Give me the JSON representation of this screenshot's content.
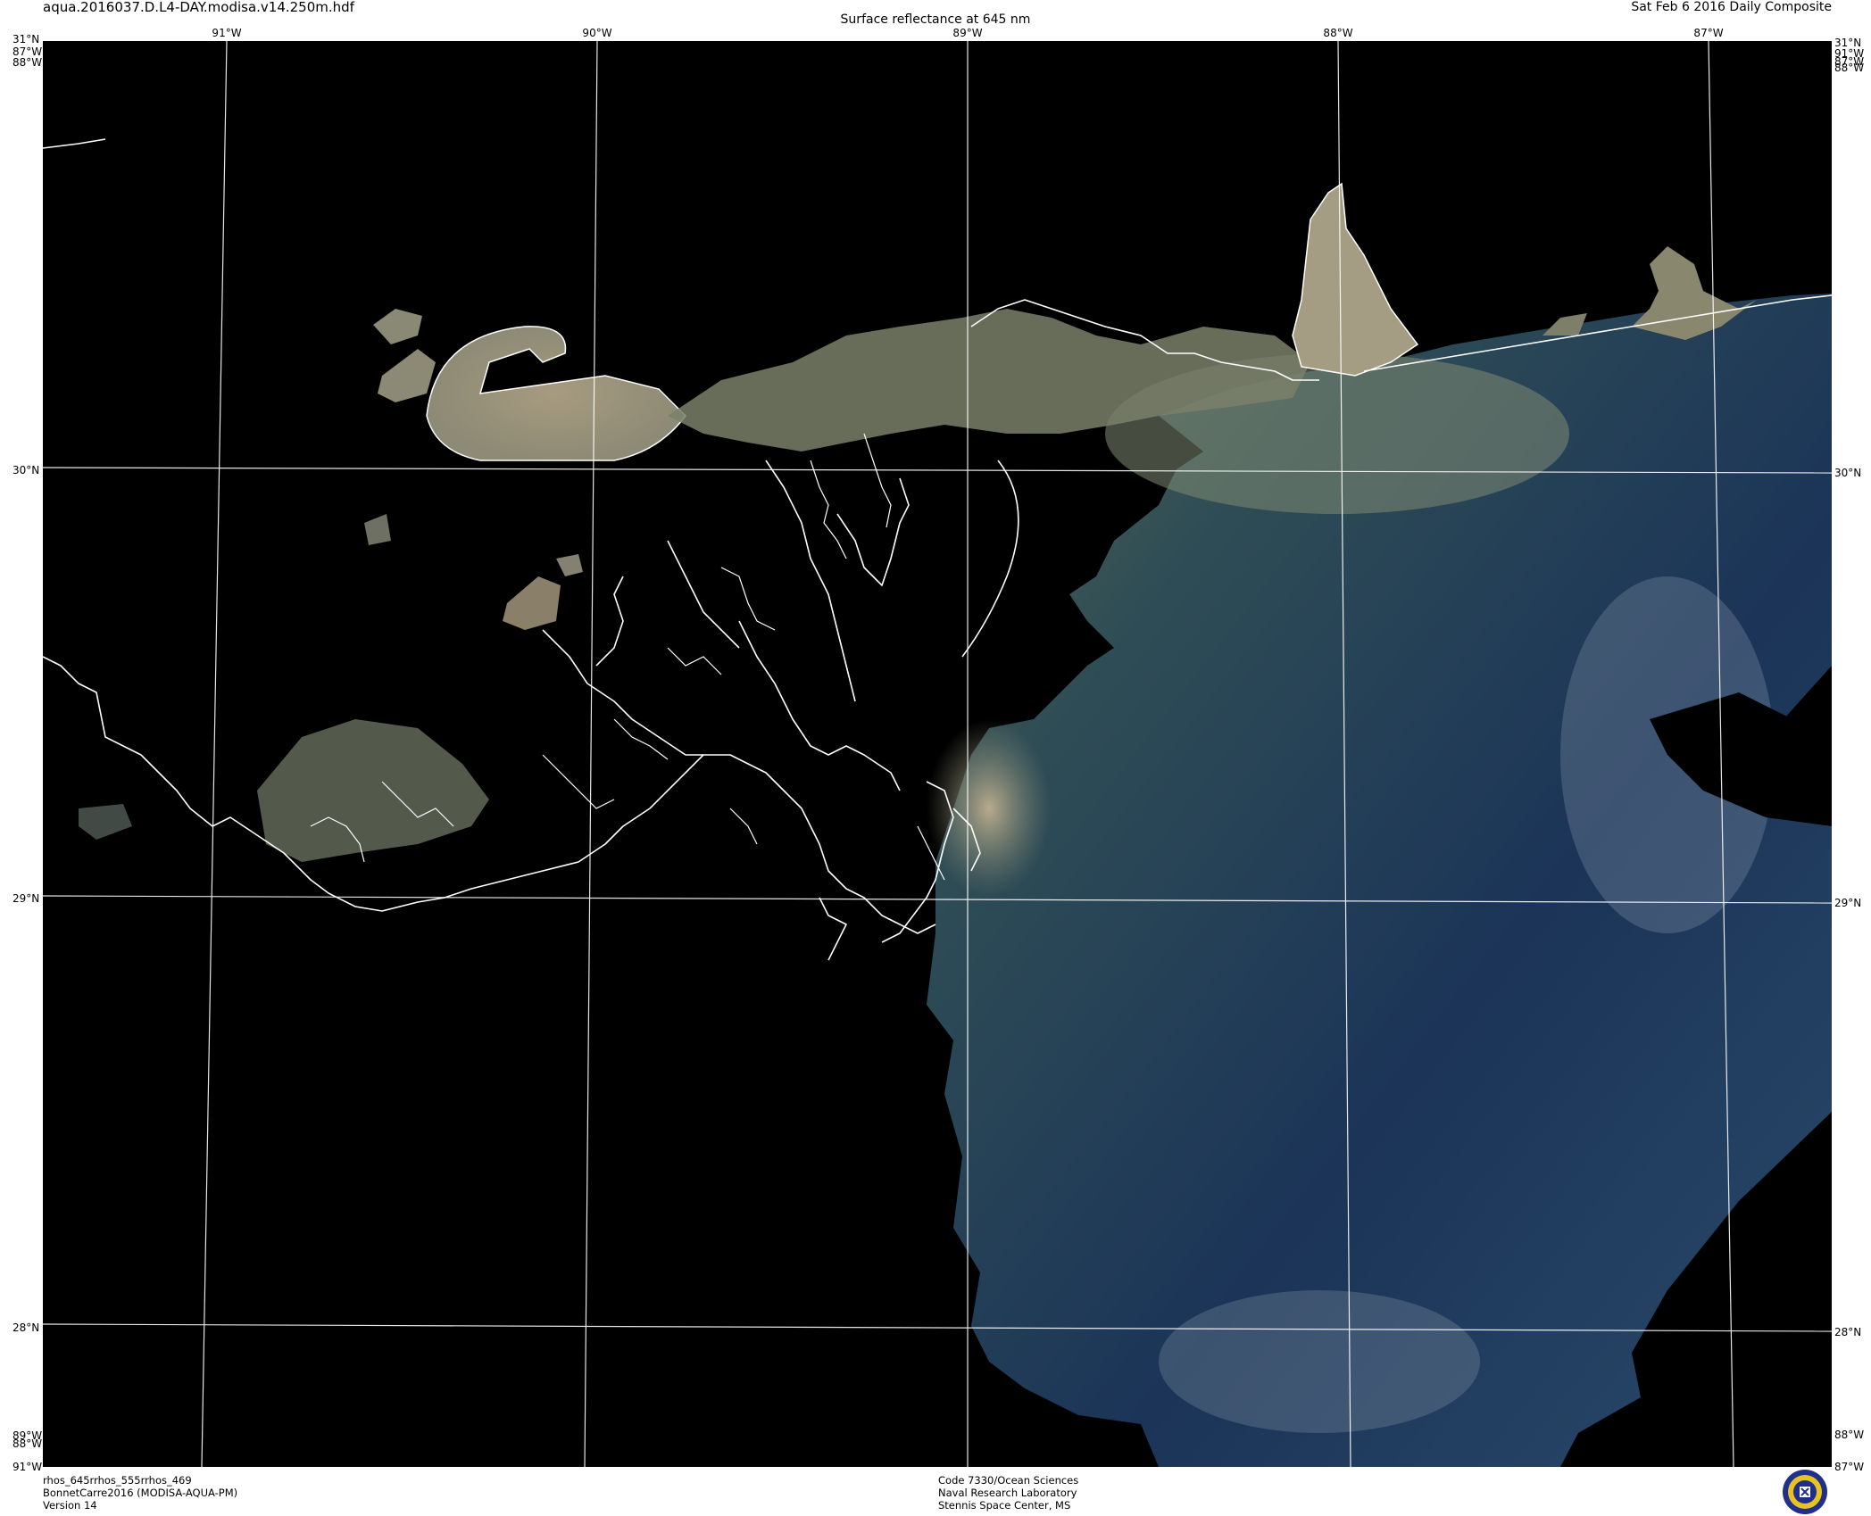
{
  "header": {
    "filename": "aqua.2016037.D.L4-DAY.modisa.v14.250m.hdf",
    "title": "Surface reflectance at 645 nm",
    "date": "Sat Feb  6 2016 Daily Composite"
  },
  "map": {
    "top_lon_labels": [
      "91°W",
      "90°W",
      "89°W",
      "88°W",
      "87°W"
    ],
    "corner_labels": {
      "top_left_lat": "31°N",
      "top_left_lon": "87°W",
      "top_left_lon2": "88°W",
      "top_right_lat": "31°N",
      "top_right_lon": "91°W",
      "top_right_lon2": "87°W",
      "top_right_lon3": "88°W",
      "bottom_left_lon": "89°W",
      "bottom_left_lon2": "88°W",
      "bottom_left_lon3": "91°W",
      "bottom_right_lon": "88°W",
      "bottom_right_lon2": "87°W"
    },
    "lat_labels": [
      "30°N",
      "29°N",
      "28°N"
    ],
    "colors": {
      "background": "#000000",
      "grid": "#ffffff",
      "coast": "#ffffff",
      "turbid_water": "#a69a7e",
      "clear_water": "#1b3458",
      "land_haze": "#6f7763"
    }
  },
  "footer": {
    "left": [
      "rhos_645rrhos_555rrhos_469",
      "BonnetCarre2016 (MODISA-AQUA-PM)",
      "Version 14"
    ],
    "center": [
      "Code 7330/Ocean Sciences",
      "Naval Research Laboratory",
      "Stennis Space Center, MS"
    ],
    "seal_icon": "nrl-seal-icon"
  }
}
